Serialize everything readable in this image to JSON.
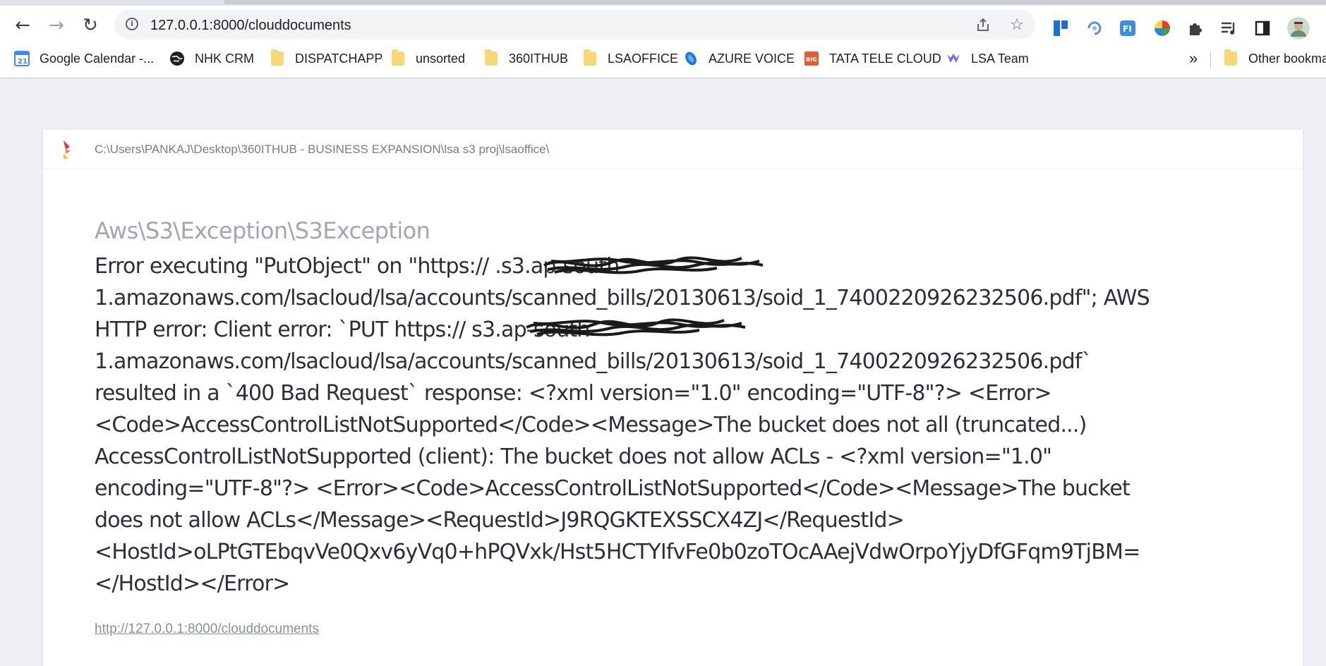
{
  "browser": {
    "url": "127.0.0.1:8000/clouddocuments",
    "bookmarks": [
      {
        "label": "Google Calendar -...",
        "icon": "google-calendar-icon"
      },
      {
        "label": "NHK CRM",
        "icon": "globe-icon"
      },
      {
        "label": "DISPATCHAPP",
        "icon": "folder-icon"
      },
      {
        "label": "unsorted",
        "icon": "folder-icon"
      },
      {
        "label": "360ITHUB",
        "icon": "folder-icon"
      },
      {
        "label": "LSAOFFICE",
        "icon": "folder-icon"
      },
      {
        "label": "AZURE VOICE",
        "icon": "azure-icon"
      },
      {
        "label": "TATA TELE CLOUD",
        "icon": "tata-icon"
      },
      {
        "label": "LSA Team",
        "icon": "lsa-team-icon"
      }
    ],
    "more_label": "»",
    "other_bookmarks": "Other bookmarks"
  },
  "page": {
    "path": "C:\\Users\\PANKAJ\\Desktop\\360ITHUB - BUSINESS EXPANSION\\lsa s3 proj\\lsaoffice\\",
    "exception_class": "Aws\\S3\\Exception\\S3Exception",
    "message_lines": [
      "Error executing \"PutObject\" on \"https://                    .s3.ap-south-",
      "1.amazonaws.com/lsacloud/lsa/accounts/scanned_bills/20130613/soid_1_7400220926232506.pdf\"; AWS",
      "HTTP error: Client error: `PUT https://                    s3.ap-south-",
      "1.amazonaws.com/lsacloud/lsa/accounts/scanned_bills/20130613/soid_1_7400220926232506.pdf`",
      "resulted in a `400 Bad Request` response: <?xml version=\"1.0\" encoding=\"UTF-8\"?> <Error>",
      "<Code>AccessControlListNotSupported</Code><Message>The bucket does not all (truncated...)",
      "AccessControlListNotSupported (client): The bucket does not allow ACLs - <?xml version=\"1.0\"",
      "encoding=\"UTF-8\"?> <Error><Code>AccessControlListNotSupported</Code><Message>The bucket",
      "does not allow ACLs</Message><RequestId>J9RQGKTEXSSCX4ZJ</RequestId>",
      "<HostId>oLPtGTEbqvVe0Qxv6yVq0+hPQVxk/Hst5HCTYIfvFe0b0zoTOcAAejVdwOrpoYjyDfGFqm9TjBM=",
      "</HostId></Error>"
    ],
    "request_url": "http://127.0.0.1:8000/clouddocuments"
  },
  "colors": {
    "page_bg": "#eef0f4",
    "card_bg": "#ffffff",
    "message_text": "#2b2f3a",
    "class_text": "#a0a6b2"
  }
}
